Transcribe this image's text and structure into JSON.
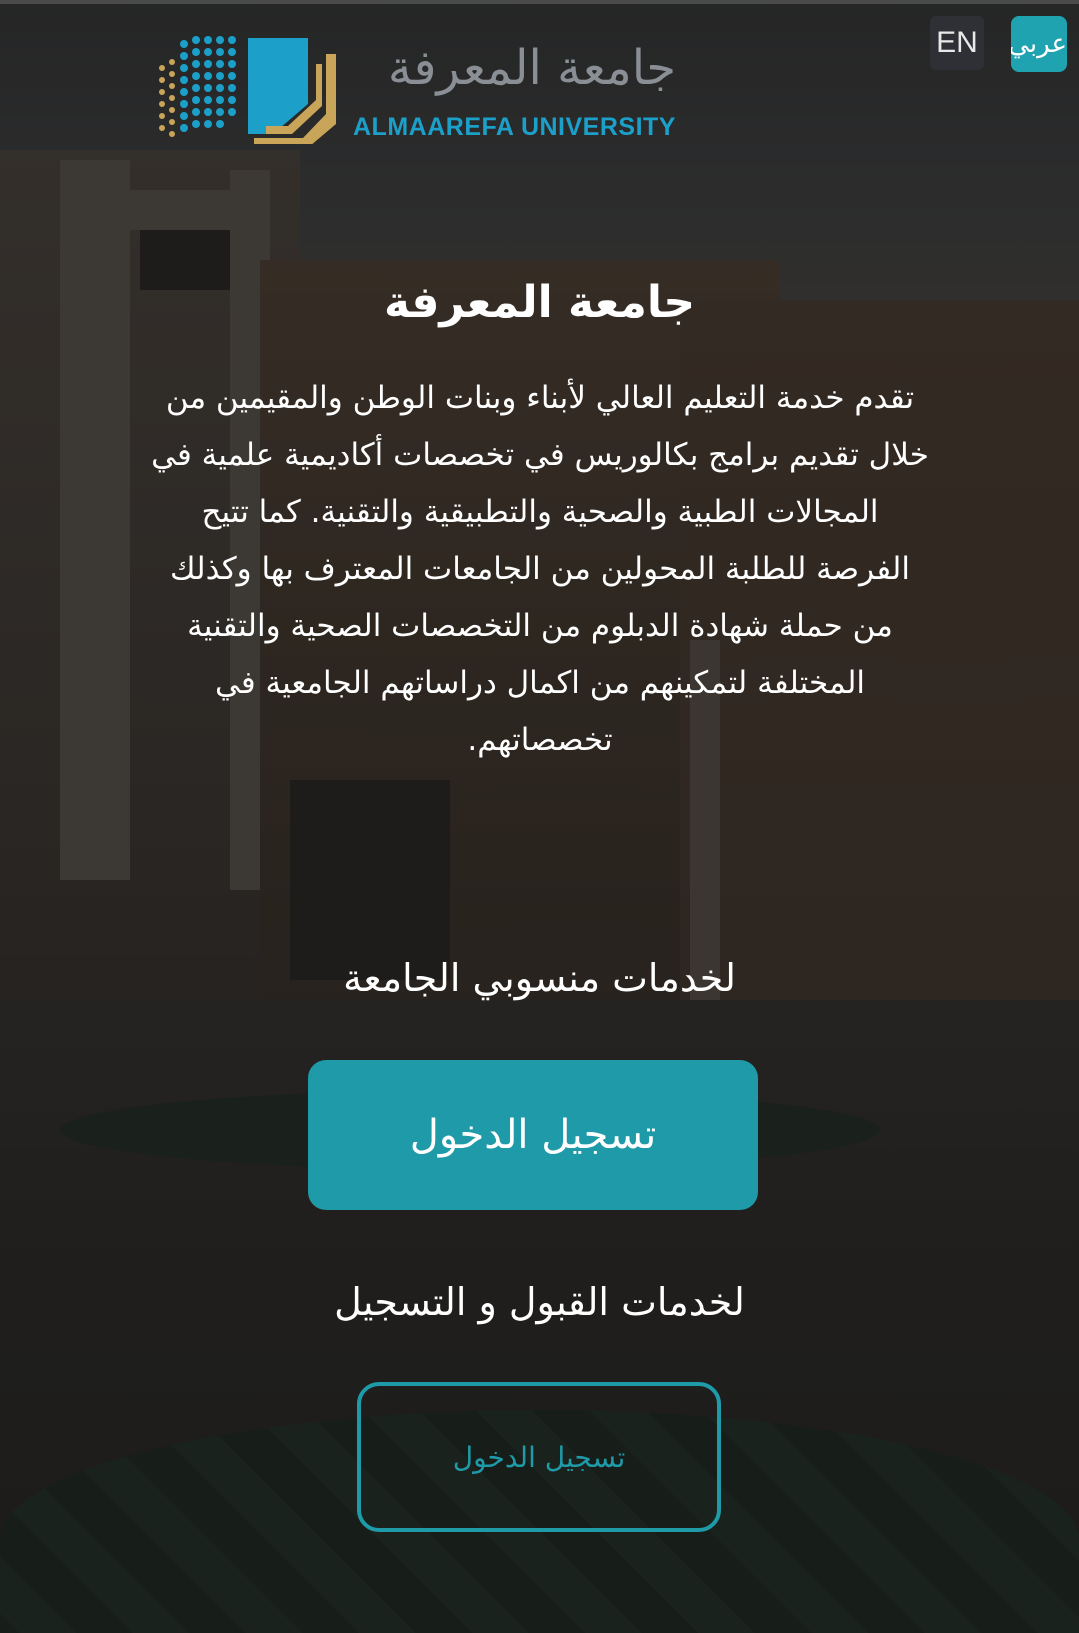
{
  "header": {
    "logo": {
      "arabic_name": "جامعة المعرفة",
      "english_name": "ALMAAREFA UNIVERSITY"
    },
    "language_buttons": {
      "english": "EN",
      "arabic": "عربي"
    }
  },
  "main": {
    "title": "جامعة المعرفة",
    "description": "تقدم خدمة التعليم العالي لأبناء وبنات الوطن والمقيمين من خلال تقديم برامج بكالوريس في تخصصات أكاديمية علمية في المجالات الطبية والصحية والتطبيقية والتقنية. كما تتيح الفرصة للطلبة المحولين من الجامعات المعترف بها وكذلك من حملة شهادة الدبلوم من التخصصات الصحية والتقنية المختلفة لتمكينهم من اكمال دراساتهم الجامعية في تخصصاتهم.",
    "staff_services": {
      "heading": "لخدمات منسوبي الجامعة",
      "button_label": "تسجيل الدخول"
    },
    "admission_services": {
      "heading": "لخدمات القبول و التسجيل",
      "button_label": "تسجيل الدخول"
    }
  },
  "colors": {
    "accent": "#1e9aa8",
    "logo_blue": "#1c9fc8",
    "logo_gold": "#c9a55a"
  }
}
